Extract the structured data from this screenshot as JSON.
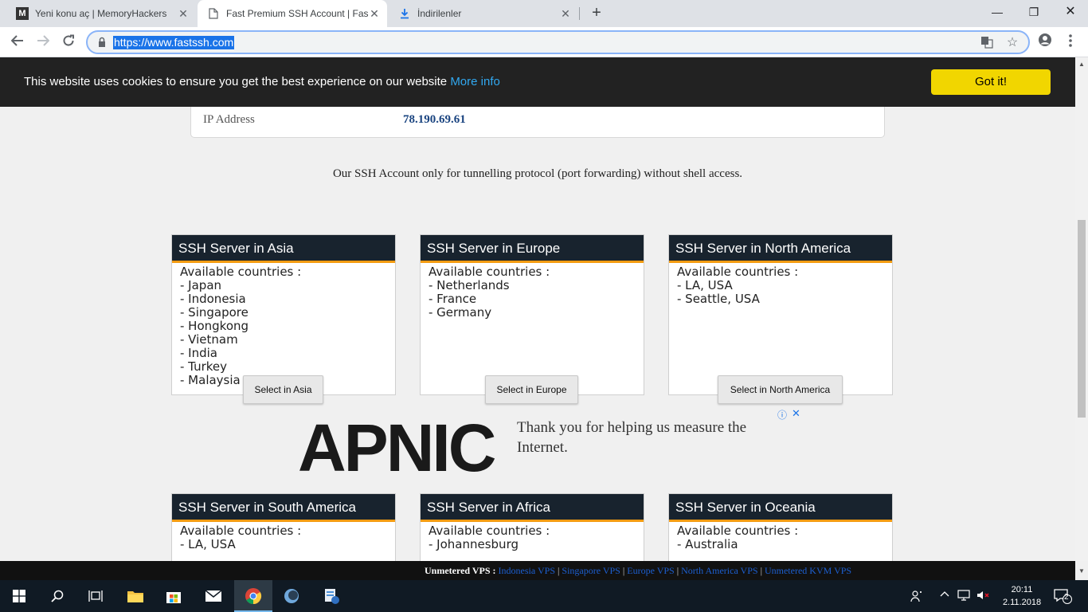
{
  "browser": {
    "tabs": [
      {
        "title": "Yeni konu aç | MemoryHackers",
        "favicon": "M"
      },
      {
        "title": "Fast Premium SSH Account | Fast",
        "favicon": "page-icon"
      },
      {
        "title": "İndirilenler",
        "favicon": "download-icon"
      }
    ],
    "url": "https://www.fastssh.com"
  },
  "cookie": {
    "message": "This website uses cookies to ensure you get the best experience on our website",
    "more_info": "More info",
    "button": "Got it!"
  },
  "ip": {
    "label": "IP Address",
    "value": "78.190.69.61"
  },
  "notice": "Our SSH Account only for tunnelling protocol (port forwarding) without shell access.",
  "servers": [
    {
      "title": "SSH Server in Asia",
      "intro": "Available countries :",
      "countries": [
        "- Japan",
        "- Indonesia",
        "- Singapore",
        "- Hongkong",
        "- Vietnam",
        "- India",
        "- Turkey",
        "- Malaysia"
      ],
      "button": "Select in Asia"
    },
    {
      "title": "SSH Server in Europe",
      "intro": "Available countries :",
      "countries": [
        "- Netherlands",
        "- France",
        "- Germany"
      ],
      "button": "Select in Europe"
    },
    {
      "title": "SSH Server in North America",
      "intro": "Available countries :",
      "countries": [
        "- LA, USA",
        "- Seattle, USA"
      ],
      "button": "Select in North America"
    },
    {
      "title": "SSH Server in South America",
      "intro": "Available countries :",
      "countries": [
        "- LA, USA"
      ]
    },
    {
      "title": "SSH Server in Africa",
      "intro": "Available countries :",
      "countries": [
        "- Johannesburg"
      ]
    },
    {
      "title": "SSH Server in Oceania",
      "intro": "Available countries :",
      "countries": [
        "- Australia"
      ]
    }
  ],
  "ad": {
    "logo": "APNIC",
    "text": "Thank you for helping us measure the Internet."
  },
  "footer": {
    "label": "Unmetered VPS :",
    "links": [
      "Indonesia VPS",
      "Singapore VPS",
      "Europe VPS",
      "North America VPS",
      "Unmetered KVM VPS"
    ]
  },
  "taskbar": {
    "time": "20:11",
    "date": "2.11.2018",
    "notifications": "2"
  }
}
